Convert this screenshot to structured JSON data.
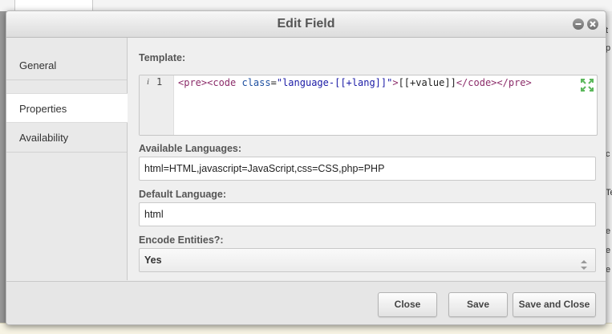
{
  "dialog": {
    "title": "Edit Field"
  },
  "sidebar": {
    "tabs": [
      {
        "label": "General"
      },
      {
        "label": "Properties"
      },
      {
        "label": "Availability"
      }
    ],
    "active_tab": "Properties"
  },
  "template": {
    "label": "Template:",
    "line_number": "1",
    "info_marker": "i",
    "code": {
      "open_pre": "<pre>",
      "open_code": "<code",
      "attr_name": " class",
      "equals": "=",
      "attr_value": "\"language-[[+lang]]\"",
      "close_bracket": ">",
      "placeholder": "[[+value]]",
      "close_code": "</code>",
      "close_pre": "</pre>"
    }
  },
  "available_languages": {
    "label": "Available Languages:",
    "value": "html=HTML,javascript=JavaScript,css=CSS,php=PHP"
  },
  "default_language": {
    "label": "Default Language:",
    "value": "html"
  },
  "encode_entities": {
    "label": "Encode Entities?:",
    "selected": "Yes"
  },
  "footer": {
    "close_label": "Close",
    "save_label": "Save",
    "save_close_label": "Save and Close"
  },
  "background": {
    "right_fragments": [
      "t",
      "p",
      "c",
      "Te",
      "e",
      "e",
      "e"
    ]
  },
  "colors": {
    "tag": "#8c2d6a",
    "attribute": "#1d4fa0",
    "string": "#1a1aa6",
    "expand_icon": "#5cb85c"
  },
  "icons": {
    "window_minimize": "minimize-icon",
    "window_close": "close-icon",
    "editor_expand": "expand-icon",
    "select_arrows": "updown-arrows-icon"
  }
}
